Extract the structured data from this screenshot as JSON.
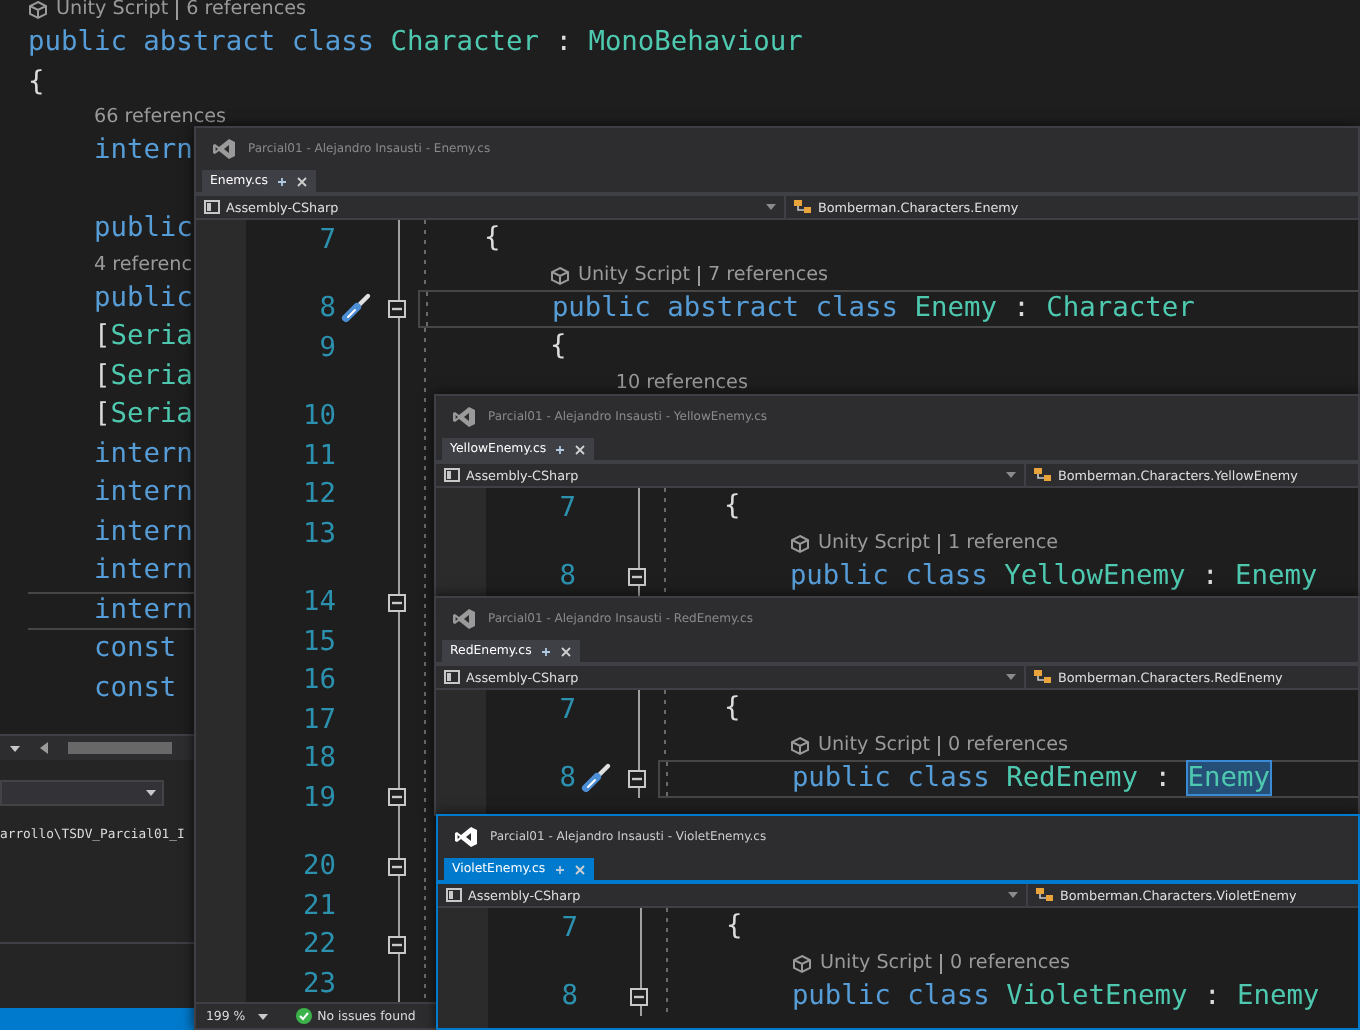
{
  "background_editor": {
    "rows": [
      {
        "kind": "unity-lens",
        "parts": [
          "Unity Script",
          "6 references"
        ]
      },
      {
        "kind": "code",
        "current": false,
        "tokens": [
          {
            "text": "public abstract class ",
            "kind": "keyword"
          },
          {
            "text": "Character",
            "kind": "type"
          },
          {
            "text": " : ",
            "kind": "plain"
          },
          {
            "text": "MonoBehaviour",
            "kind": "type"
          }
        ]
      },
      {
        "kind": "code",
        "current": false,
        "tokens": [
          {
            "text": "{",
            "kind": "plain"
          }
        ]
      },
      {
        "kind": "lens",
        "indent": "    ",
        "parts": [
          "66 references"
        ]
      },
      {
        "kind": "code",
        "indent": "    ",
        "current": false,
        "tokens": [
          {
            "text": "intern",
            "kind": "keyword"
          }
        ]
      },
      {
        "kind": "code",
        "current": false
      },
      {
        "kind": "code",
        "indent": "    ",
        "current": false,
        "tokens": [
          {
            "text": "public",
            "kind": "keyword"
          }
        ]
      },
      {
        "kind": "lens",
        "indent": "    ",
        "parts": [
          "4 referenc"
        ]
      },
      {
        "kind": "code",
        "indent": "    ",
        "current": false,
        "tokens": [
          {
            "text": "public",
            "kind": "keyword"
          }
        ]
      },
      {
        "kind": "code",
        "indent": "    ",
        "current": false,
        "tokens": [
          {
            "text": "[",
            "kind": "plain"
          },
          {
            "text": "Seria",
            "kind": "type"
          }
        ]
      },
      {
        "kind": "code",
        "indent": "    ",
        "current": false,
        "tokens": [
          {
            "text": "[",
            "kind": "plain"
          },
          {
            "text": "Seria",
            "kind": "type"
          }
        ]
      },
      {
        "kind": "code",
        "indent": "    ",
        "current": false,
        "tokens": [
          {
            "text": "[",
            "kind": "plain"
          },
          {
            "text": "Seria",
            "kind": "type"
          }
        ]
      },
      {
        "kind": "code",
        "indent": "    ",
        "current": false,
        "tokens": [
          {
            "text": "intern",
            "kind": "keyword"
          }
        ]
      },
      {
        "kind": "code",
        "indent": "    ",
        "current": false,
        "tokens": [
          {
            "text": "intern",
            "kind": "keyword"
          }
        ]
      },
      {
        "kind": "code",
        "indent": "    ",
        "current": false,
        "tokens": [
          {
            "text": "intern",
            "kind": "keyword"
          }
        ]
      },
      {
        "kind": "code",
        "indent": "    ",
        "current": false,
        "tokens": [
          {
            "text": "intern",
            "kind": "keyword"
          }
        ]
      },
      {
        "kind": "code",
        "indent": "    ",
        "current": true,
        "tokens": [
          {
            "text": "intern",
            "kind": "keyword"
          }
        ]
      },
      {
        "kind": "code",
        "indent": "    ",
        "current": false,
        "tokens": [
          {
            "text": "const",
            "kind": "keyword"
          }
        ]
      },
      {
        "kind": "code",
        "indent": "    ",
        "current": false,
        "tokens": [
          {
            "text": "const",
            "kind": "keyword"
          }
        ]
      }
    ]
  },
  "output_panel": {
    "path": "arrollo\\TSDV_Parcial01_I"
  },
  "windows": [
    {
      "title": "Parcial01 - Alejandro Insausti - Enemy.cs",
      "active": false,
      "tab": "Enemy.cs",
      "project": "Assembly-CSharp",
      "member": "Bomberman.Characters.Enemy",
      "rows": [
        {
          "kind": "code",
          "number": "7",
          "fold": false,
          "brush": false,
          "current": false,
          "indent": "    ",
          "tokens": [
            {
              "text": "{",
              "kind": "plain"
            }
          ]
        },
        {
          "kind": "unity-lens",
          "indent": "        ",
          "parts": [
            "Unity Script",
            "7 references"
          ]
        },
        {
          "kind": "code",
          "number": "8",
          "fold": true,
          "brush": true,
          "current": true,
          "indent": "        ",
          "tokens": [
            {
              "text": "public abstract class ",
              "kind": "keyword"
            },
            {
              "text": "Enemy",
              "kind": "type"
            },
            {
              "text": " : ",
              "kind": "plain"
            },
            {
              "text": "Character",
              "kind": "type"
            }
          ]
        },
        {
          "kind": "code",
          "number": "9",
          "fold": false,
          "brush": false,
          "current": false,
          "indent": "        ",
          "tokens": [
            {
              "text": "{",
              "kind": "plain"
            }
          ]
        },
        {
          "kind": "lens",
          "indent": "            ",
          "parts": [
            "10 references"
          ]
        },
        {
          "kind": "code",
          "number": "10",
          "fold": false,
          "brush": false,
          "current": false
        },
        {
          "kind": "code",
          "number": "11",
          "fold": false,
          "brush": false,
          "current": false
        },
        {
          "kind": "code",
          "number": "12",
          "fold": false,
          "brush": false,
          "current": false
        },
        {
          "kind": "code",
          "number": "13",
          "fold": false,
          "brush": false,
          "current": false
        },
        {
          "kind": "lens"
        },
        {
          "kind": "code",
          "number": "14",
          "fold": true,
          "brush": false,
          "current": false
        },
        {
          "kind": "code",
          "number": "15",
          "fold": false,
          "brush": false,
          "current": false
        },
        {
          "kind": "code",
          "number": "16",
          "fold": false,
          "brush": false,
          "current": false
        },
        {
          "kind": "code",
          "number": "17",
          "fold": false,
          "brush": false,
          "current": false
        },
        {
          "kind": "code",
          "number": "18",
          "fold": false,
          "brush": false,
          "current": false
        },
        {
          "kind": "code",
          "number": "19",
          "fold": true,
          "brush": false,
          "current": false
        },
        {
          "kind": "lens"
        },
        {
          "kind": "code",
          "number": "20",
          "fold": true,
          "brush": false,
          "current": false
        },
        {
          "kind": "code",
          "number": "21",
          "fold": false,
          "brush": false,
          "current": false
        },
        {
          "kind": "code",
          "number": "22",
          "fold": true,
          "brush": false,
          "current": false
        },
        {
          "kind": "code",
          "number": "23",
          "fold": false,
          "brush": false,
          "current": false
        }
      ],
      "status": {
        "zoom": "199 %",
        "issues": "No issues found"
      }
    },
    {
      "title": "Parcial01 - Alejandro Insausti - YellowEnemy.cs",
      "active": false,
      "tab": "YellowEnemy.cs",
      "project": "Assembly-CSharp",
      "member": "Bomberman.Characters.YellowEnemy",
      "rows": [
        {
          "kind": "code",
          "number": "7",
          "fold": false,
          "brush": false,
          "current": false,
          "indent": "    ",
          "tokens": [
            {
              "text": "{",
              "kind": "plain"
            }
          ]
        },
        {
          "kind": "unity-lens",
          "indent": "        ",
          "parts": [
            "Unity Script",
            "1 reference"
          ]
        },
        {
          "kind": "code",
          "number": "8",
          "fold": true,
          "brush": false,
          "current": false,
          "indent": "        ",
          "tokens": [
            {
              "text": "public class ",
              "kind": "keyword"
            },
            {
              "text": "YellowEnemy",
              "kind": "type"
            },
            {
              "text": " : ",
              "kind": "plain"
            },
            {
              "text": "Enemy",
              "kind": "type"
            }
          ]
        }
      ]
    },
    {
      "title": "Parcial01 - Alejandro Insausti - RedEnemy.cs",
      "active": false,
      "tab": "RedEnemy.cs",
      "project": "Assembly-CSharp",
      "member": "Bomberman.Characters.RedEnemy",
      "rows": [
        {
          "kind": "code",
          "number": "7",
          "fold": false,
          "brush": false,
          "current": false,
          "indent": "    ",
          "tokens": [
            {
              "text": "{",
              "kind": "plain"
            }
          ]
        },
        {
          "kind": "unity-lens",
          "indent": "        ",
          "parts": [
            "Unity Script",
            "0 references"
          ]
        },
        {
          "kind": "code",
          "number": "8",
          "fold": true,
          "brush": true,
          "current": true,
          "indent": "        ",
          "tokens": [
            {
              "text": "public class ",
              "kind": "keyword"
            },
            {
              "text": "RedEnemy",
              "kind": "type"
            },
            {
              "text": " : ",
              "kind": "plain"
            },
            {
              "text": "Enemy",
              "kind": "type-selected"
            }
          ]
        }
      ]
    },
    {
      "title": "Parcial01 - Alejandro Insausti - VioletEnemy.cs",
      "active": true,
      "tab": "VioletEnemy.cs",
      "project": "Assembly-CSharp",
      "member": "Bomberman.Characters.VioletEnemy",
      "rows": [
        {
          "kind": "code",
          "number": "7",
          "fold": false,
          "brush": false,
          "current": false,
          "indent": "    ",
          "tokens": [
            {
              "text": "{",
              "kind": "plain"
            }
          ]
        },
        {
          "kind": "unity-lens",
          "indent": "        ",
          "parts": [
            "Unity Script",
            "0 references"
          ]
        },
        {
          "kind": "code",
          "number": "8",
          "fold": true,
          "brush": false,
          "current": false,
          "indent": "        ",
          "tokens": [
            {
              "text": "public class ",
              "kind": "keyword"
            },
            {
              "text": "VioletEnemy",
              "kind": "type"
            },
            {
              "text": " : ",
              "kind": "plain"
            },
            {
              "text": "Enemy",
              "kind": "type"
            }
          ]
        }
      ]
    }
  ]
}
